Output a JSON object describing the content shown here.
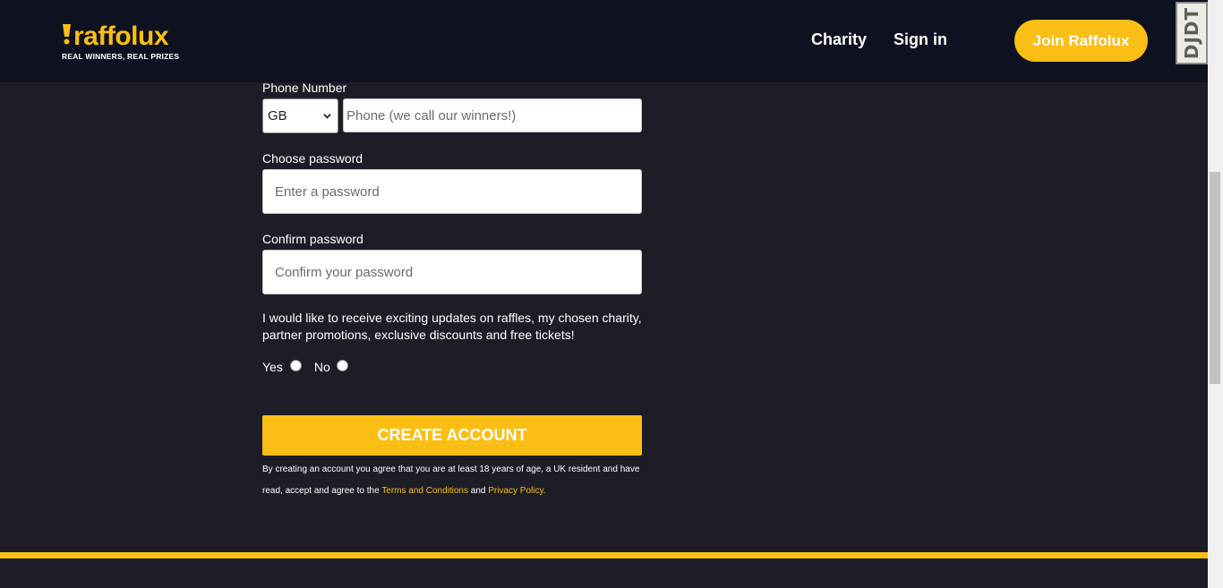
{
  "header": {
    "logo_text": "raffolux",
    "logo_tagline": "REAL WINNERS, REAL PRIZES",
    "nav": {
      "charity": "Charity",
      "sign_in": "Sign in"
    },
    "join_button": "Join Raffolux",
    "debug_toolbar": "DJDT"
  },
  "form": {
    "phone_label": "Phone Number",
    "country_selected": "GB",
    "phone_placeholder": "Phone (we call our winners!)",
    "password_label": "Choose password",
    "password_placeholder": "Enter a password",
    "confirm_label": "Confirm password",
    "confirm_placeholder": "Confirm your password",
    "consent_text": "I would like to receive exciting updates on raffles, my chosen charity, partner promotions, exclusive discounts and free tickets!",
    "radio_yes": "Yes",
    "radio_no": "No",
    "submit_button": "CREATE ACCOUNT",
    "legal_prefix": "By creating an account you agree that you are at least 18 years of age, a UK resident and have read, accept and agree to the",
    "terms_link": "Terms and Conditions",
    "legal_and": "and",
    "privacy_link": "Privacy Policy."
  },
  "colors": {
    "accent": "#fbbe14",
    "header_bg": "#0e1120",
    "page_bg": "#1c1d26"
  },
  "icons": {
    "logo": "raffolux-logo",
    "select_chevron": "chevron-down-icon"
  }
}
